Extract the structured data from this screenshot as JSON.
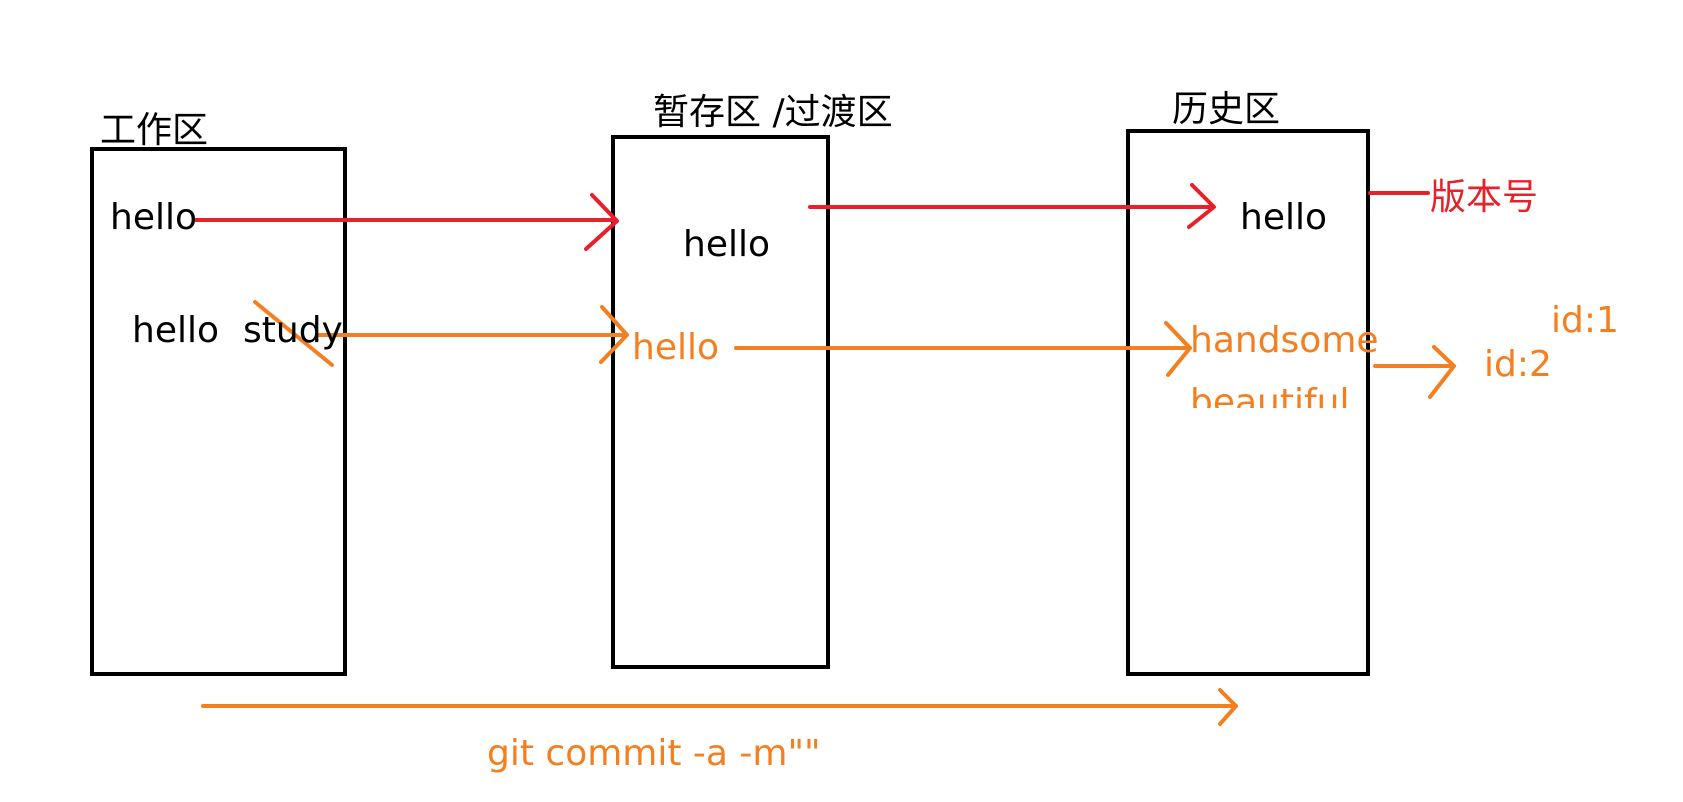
{
  "colors": {
    "ink": "#000000",
    "red": "#e8202a",
    "orange": "#f47f20"
  },
  "zones": {
    "working": {
      "label": "工作区",
      "line1": "hello",
      "line2_a": "hello",
      "line2_b": "study"
    },
    "staging": {
      "label": "暂存区 /过渡区",
      "line1": "hello",
      "line2": "hello"
    },
    "history": {
      "label": "历史区",
      "line1": "hello",
      "line2": "handsome",
      "line3": "beautiful"
    }
  },
  "annotations": {
    "version_label": "版本号",
    "id1": "id:1",
    "id2": "id:2",
    "command": "git commit -a -m\"\""
  }
}
